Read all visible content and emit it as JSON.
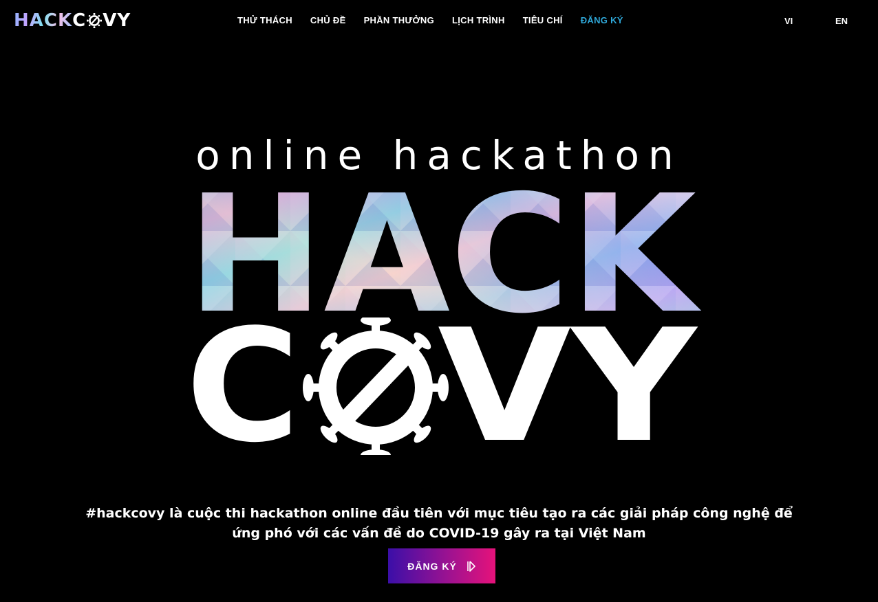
{
  "logo": {
    "holo_text": "HACK",
    "plain_text": "VY",
    "c_letter": "C"
  },
  "nav": {
    "items": [
      {
        "label": "THỬ THÁCH"
      },
      {
        "label": "CHỦ ĐỀ"
      },
      {
        "label": "PHẦN THƯỞNG"
      },
      {
        "label": "LỊCH TRÌNH"
      },
      {
        "label": "TIÊU CHÍ"
      },
      {
        "label": "ĐĂNG KÝ",
        "active": true
      }
    ],
    "active_color": "#2fa8d9"
  },
  "languages": {
    "vi": "VI",
    "en": "EN"
  },
  "hero": {
    "tagline": "online hackathon",
    "title_top": "HACK",
    "title_bottom_c": "C",
    "title_bottom_rest": "VY",
    "description_line1": "#hackcovy là cuộc thi hackathon online đầu tiên với mục tiêu tạo ra các giải pháp công nghệ để",
    "description_line2": "ứng phó với các vấn đề do COVID-19 gây ra tại Việt Nam",
    "cta_label": "ĐĂNG KÝ",
    "cta_icon": "play-arrow-icon",
    "cta_gradient": [
      "#3b0fa8",
      "#e6127a"
    ]
  },
  "colors": {
    "background": "#000000",
    "text": "#ffffff"
  }
}
